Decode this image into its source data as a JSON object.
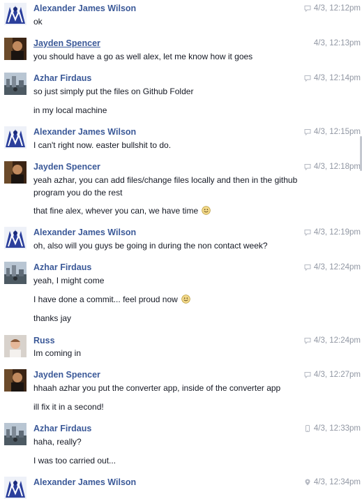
{
  "messages": [
    {
      "sender": "Alexander James Wilson",
      "avatar": "alex",
      "time": "4/3, 12:12pm",
      "status": "chat",
      "lines": [
        {
          "text": "ok"
        }
      ]
    },
    {
      "sender": "Jayden Spencer",
      "avatar": "jayden",
      "time": "4/3, 12:13pm",
      "status": "none",
      "lines": [
        {
          "text": "you should have a go as well alex, let me know how it goes"
        }
      ]
    },
    {
      "sender": "Azhar Firdaus",
      "avatar": "azhar",
      "time": "4/3, 12:14pm",
      "status": "chat",
      "lines": [
        {
          "text": "so just simply put the files on Github Folder"
        },
        {
          "text": "in my local machine"
        }
      ]
    },
    {
      "sender": "Alexander James Wilson",
      "avatar": "alex",
      "time": "4/3, 12:15pm",
      "status": "chat",
      "lines": [
        {
          "text": "I can't right now. easter bullshit to do."
        }
      ]
    },
    {
      "sender": "Jayden Spencer",
      "avatar": "jayden",
      "time": "4/3, 12:18pm",
      "status": "chat",
      "lines": [
        {
          "text": "yeah azhar, you can add files/change files locally and then in the github"
        },
        {
          "text": "program you do the rest"
        },
        {
          "text": "that fine alex, whever you can, we have time",
          "emoji": "smile"
        }
      ]
    },
    {
      "sender": "Alexander James Wilson",
      "avatar": "alex",
      "time": "4/3, 12:19pm",
      "status": "chat",
      "lines": [
        {
          "text": "oh, also will you guys be going in during the non contact week?"
        }
      ]
    },
    {
      "sender": "Azhar Firdaus",
      "avatar": "azhar",
      "time": "4/3, 12:24pm",
      "status": "chat",
      "lines": [
        {
          "text": "yeah, I might come"
        },
        {
          "text": "I have done a commit... feel proud now",
          "emoji": "smile"
        },
        {
          "text": "thanks jay"
        }
      ]
    },
    {
      "sender": "Russ",
      "avatar": "russ",
      "time": "4/3, 12:24pm",
      "status": "chat",
      "lines": [
        {
          "text": "Im coming in"
        }
      ]
    },
    {
      "sender": "Jayden Spencer",
      "avatar": "jayden",
      "time": "4/3, 12:27pm",
      "status": "chat",
      "lines": [
        {
          "text": "hhaah azhar you put the converter app, inside of the converter app"
        },
        {
          "text": "ill fix it in a second!"
        }
      ]
    },
    {
      "sender": "Azhar Firdaus",
      "avatar": "azhar",
      "time": "4/3, 12:33pm",
      "status": "mobile",
      "lines": [
        {
          "text": "haha, really?"
        },
        {
          "text": "I was too carried out..."
        }
      ]
    },
    {
      "sender": "Alexander James Wilson",
      "avatar": "alex",
      "time": "4/3, 12:34pm",
      "status": "location",
      "lines": []
    }
  ],
  "icons": {
    "chat": "chat-bubble-icon",
    "mobile": "mobile-phone-icon",
    "location": "location-pin-icon",
    "smile": "smiley-emoji-icon"
  }
}
